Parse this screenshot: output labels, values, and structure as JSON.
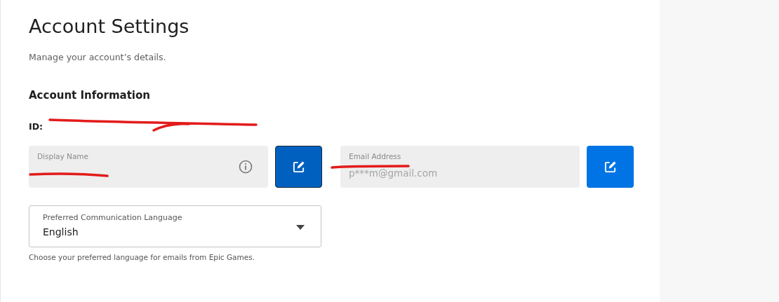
{
  "page": {
    "title": "Account Settings",
    "subtitle": "Manage your account’s details."
  },
  "section": {
    "title": "Account Information",
    "id_label": "ID:"
  },
  "fields": [
    {
      "label": "Display Name",
      "info": true,
      "redacted": true,
      "edit_focused": true
    },
    {
      "label": "Email Address",
      "value": "p***m@gmail.com",
      "info": false,
      "redacted": false,
      "edit_focused": false
    }
  ],
  "language": {
    "label": "Preferred Communication Language",
    "value": "English",
    "help": "Choose your preferred language for emails from Epic Games."
  }
}
